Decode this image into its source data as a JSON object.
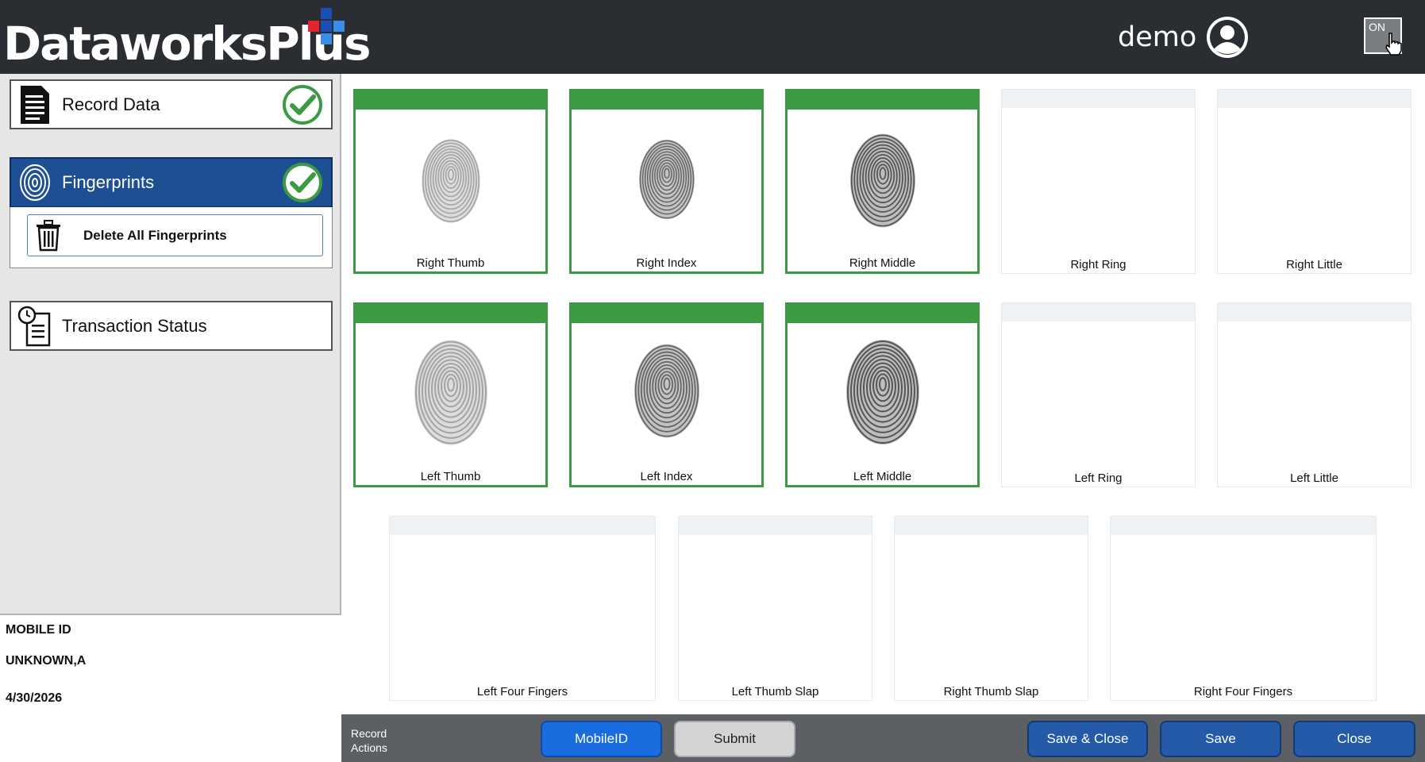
{
  "header": {
    "logo_text": "DataworksPlus",
    "user_name": "demo",
    "toggle_label": "ON",
    "logo_colors": [
      "#1b4fb3",
      "#e0262f",
      "#3a8ee6"
    ]
  },
  "sidebar": {
    "record_data": "Record Data",
    "fingerprints": "Fingerprints",
    "delete_all": "Delete All Fingerprints",
    "transaction_status": "Transaction Status"
  },
  "info": {
    "line1": "MOBILE ID",
    "line2": "UNKNOWN,A",
    "line3": "4/30/2026"
  },
  "fingers": {
    "row1": [
      {
        "label": "Right Thumb",
        "captured": true
      },
      {
        "label": "Right Index",
        "captured": true
      },
      {
        "label": "Right Middle",
        "captured": true
      },
      {
        "label": "Right Ring",
        "captured": false
      },
      {
        "label": "Right Little",
        "captured": false
      }
    ],
    "row2": [
      {
        "label": "Left Thumb",
        "captured": true
      },
      {
        "label": "Left Index",
        "captured": true
      },
      {
        "label": "Left Middle",
        "captured": true
      },
      {
        "label": "Left Ring",
        "captured": false
      },
      {
        "label": "Left Little",
        "captured": false
      }
    ],
    "row3": [
      {
        "label": "Left Four Fingers",
        "captured": false
      },
      {
        "label": "Left Thumb Slap",
        "captured": false
      },
      {
        "label": "Right Thumb Slap",
        "captured": false
      },
      {
        "label": "Right Four Fingers",
        "captured": false
      }
    ]
  },
  "footer": {
    "title": "Record Actions",
    "mobileid": "MobileID",
    "submit": "Submit",
    "save_close": "Save & Close",
    "save": "Save",
    "close": "Close"
  },
  "colors": {
    "captured_green": "#3c9a45",
    "nav_active": "#1f4f93",
    "header_bg": "#2a2d32"
  }
}
